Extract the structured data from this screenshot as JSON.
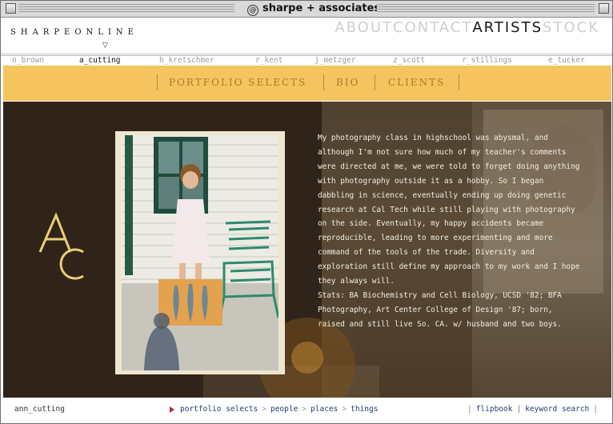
{
  "window": {
    "title": "sharpe + associates",
    "logo_glyph": "@"
  },
  "header": {
    "brand": "SHARPEONLINE",
    "brand_arrow": "▽",
    "nav": [
      "ABOUT",
      "CONTACT",
      "ARTISTS",
      "STOCK"
    ],
    "active_nav": "ARTISTS"
  },
  "artists": [
    {
      "label": "n_brown",
      "active": false
    },
    {
      "label": "a_cutting",
      "active": true
    },
    {
      "label": "h_kretschmer",
      "active": false
    },
    {
      "label": "r_kent",
      "active": false
    },
    {
      "label": "j_metzger",
      "active": false
    },
    {
      "label": "z_scott",
      "active": false
    },
    {
      "label": "r_stillings",
      "active": false
    },
    {
      "label": "e_tucker",
      "active": false
    }
  ],
  "subnav": {
    "items": [
      "PORTFOLIO SELECTS",
      "BIO",
      "CLIENTS"
    ]
  },
  "monogram": {
    "letters": "AC",
    "color": "#e8cf76"
  },
  "bio": {
    "paragraph": "My photography class in highschool was abysmal, and although I'm not sure how much of my teacher's comments were directed at me, we were told to forget doing anything with photography outside it as a hobby. So I began dabbling in science, eventually ending up doing genetic research at Cal Tech while still playing with photography on the side. Eventually, my happy accidents became reproducible, leading to more experimenting and more command of the tools of the trade. Diversity and exploration still define my approach to my work and I hope they always will.",
    "stats": "Stats: BA Biochemistry and Cell Biology, UCSD '82; BFA Photography, Art Center College of Design '87; born, raised and still live So. CA. w/ husband and two boys."
  },
  "footer": {
    "user": "ann_cutting",
    "crumbs": [
      "portfolio selects",
      "people",
      "places",
      "things"
    ],
    "crumb_sep": ">",
    "right_links": [
      "flipbook",
      "keyword search"
    ],
    "link_sep": "|"
  },
  "colors": {
    "accent": "#f6c45e",
    "background": "#302319",
    "link": "#1e3f74",
    "marker": "#b3312d"
  }
}
